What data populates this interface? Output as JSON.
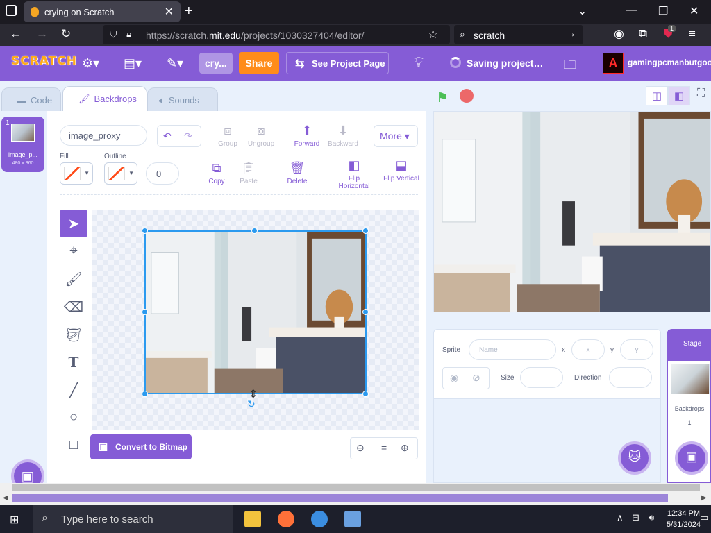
{
  "browser": {
    "tab_title": "crying on Scratch",
    "url_prefix": "https://scratch.",
    "url_host": "mit.edu",
    "url_path": "/projects/1030327404/editor/",
    "search_text": "scratch",
    "extension_badge": "1"
  },
  "menubar": {
    "logo": "SCRATCH",
    "project_title": "cry...",
    "share_label": "Share",
    "see_project_label": "See Project Page",
    "saving_label": "Saving project…",
    "username": "gamingpcmanbutgoo",
    "accent": "#855cd6",
    "share_color": "#ff8c1a"
  },
  "tabs": {
    "code": "Code",
    "backdrops": "Backdrops",
    "sounds": "Sounds"
  },
  "backdrop_list": [
    {
      "number": "1",
      "name": "image_p...",
      "size": "480 x 360"
    }
  ],
  "paint": {
    "costume_name": "image_proxy",
    "group": "Group",
    "ungroup": "Ungroup",
    "forward": "Forward",
    "backward": "Backward",
    "more": "More",
    "fill_label": "Fill",
    "outline_label": "Outline",
    "outline_width": "0",
    "copy": "Copy",
    "paste": "Paste",
    "delete": "Delete",
    "flip_h": "Flip Horizontal",
    "flip_v": "Flip Vertical",
    "convert": "Convert to Bitmap",
    "zoom_reset": "="
  },
  "sprite_info": {
    "sprite_label": "Sprite",
    "name_placeholder": "Name",
    "x_label": "x",
    "x_placeholder": "x",
    "y_label": "y",
    "y_placeholder": "y",
    "size_label": "Size",
    "direction_label": "Direction"
  },
  "stage_pane": {
    "title": "Stage",
    "backdrops_label": "Backdrops",
    "backdrops_count": "1"
  },
  "taskbar": {
    "search_placeholder": "Type here to search",
    "time": "12:34 PM",
    "date": "5/31/2024"
  }
}
